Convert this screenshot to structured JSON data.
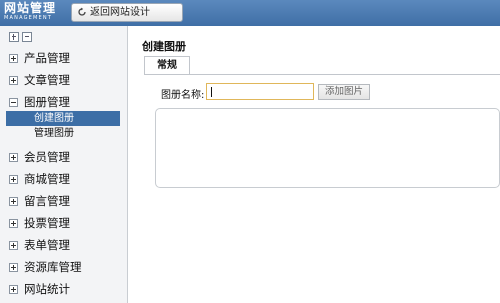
{
  "header": {
    "brand_title": "网站管理",
    "brand_subtitle": "MANAGEMENT",
    "back_button_label": "返回网站设计"
  },
  "sidebar": {
    "toolbar_icons": [
      "expand-all-icon",
      "collapse-all-icon"
    ],
    "items": [
      {
        "label": "产品管理",
        "state": "collapsed"
      },
      {
        "label": "文章管理",
        "state": "collapsed"
      },
      {
        "label": "图册管理",
        "state": "expanded",
        "children": [
          {
            "label": "创建图册",
            "active": true
          },
          {
            "label": "管理图册",
            "active": false
          }
        ]
      },
      {
        "label": "会员管理",
        "state": "collapsed"
      },
      {
        "label": "商城管理",
        "state": "collapsed"
      },
      {
        "label": "留言管理",
        "state": "collapsed"
      },
      {
        "label": "投票管理",
        "state": "collapsed"
      },
      {
        "label": "表单管理",
        "state": "collapsed"
      },
      {
        "label": "资源库管理",
        "state": "collapsed"
      },
      {
        "label": "网站统计",
        "state": "collapsed"
      }
    ]
  },
  "main": {
    "page_title": "创建图册",
    "tabs": [
      {
        "label": "常规",
        "active": true
      }
    ],
    "form": {
      "name_label": "图册名称:",
      "name_value": "",
      "add_image_button": "添加图片"
    }
  },
  "colors": {
    "header_bg": "#3f6fa6",
    "active_item_bg": "#3c6ea6",
    "input_focus_border": "#e0b75a"
  }
}
